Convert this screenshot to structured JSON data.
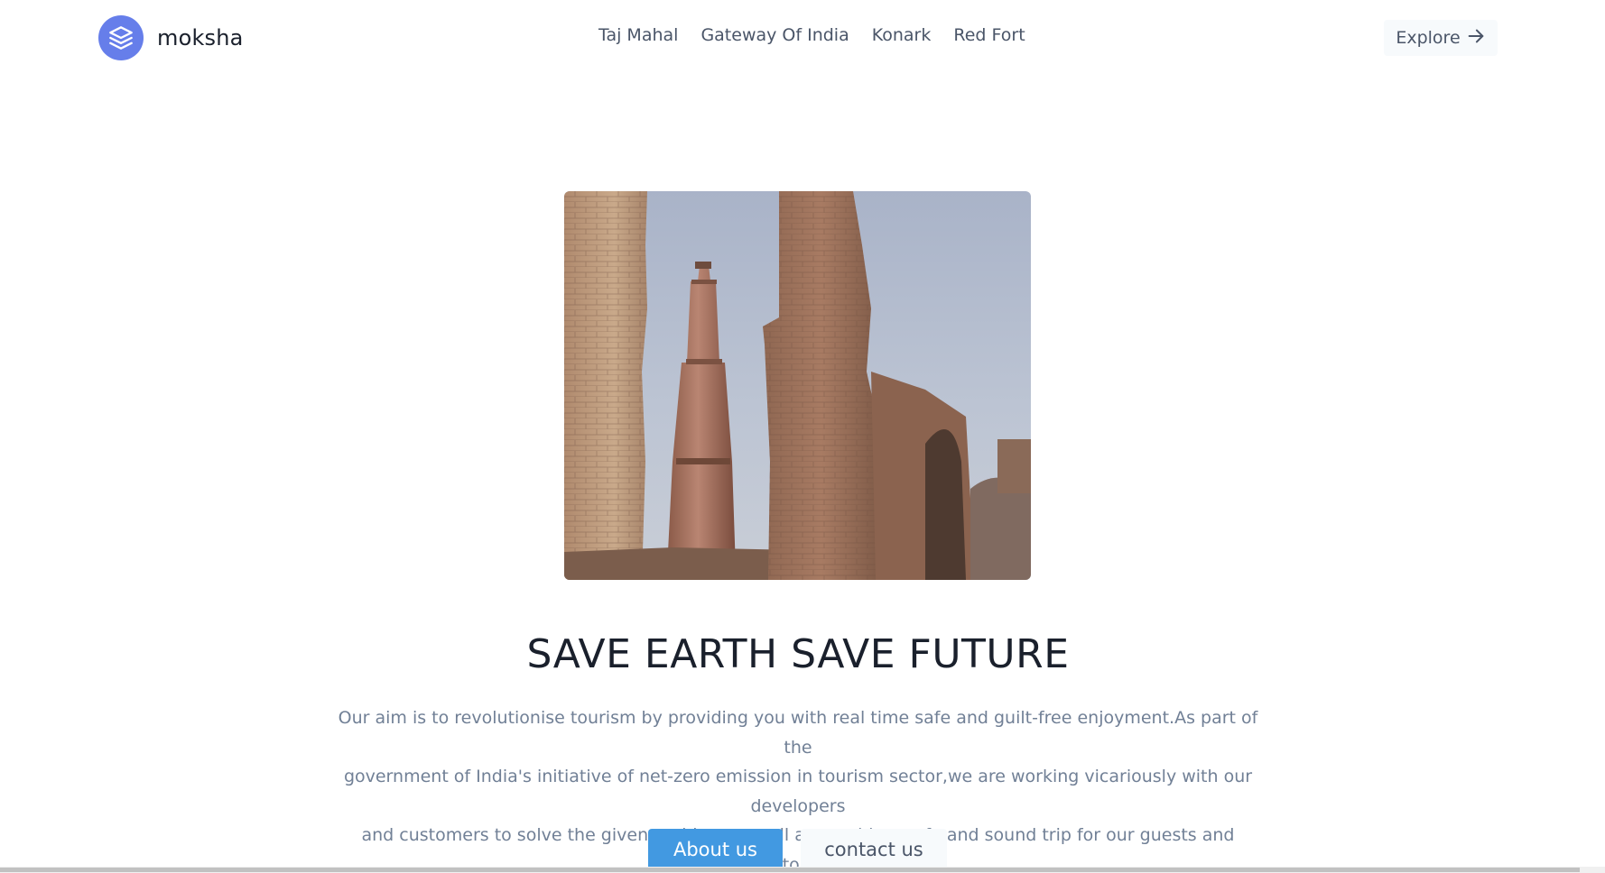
{
  "brand": {
    "name": "moksha",
    "icon": "layers-icon",
    "color": "#667eea"
  },
  "nav": {
    "items": [
      {
        "label": "Taj Mahal"
      },
      {
        "label": "Gateway Of India"
      },
      {
        "label": "Konark"
      },
      {
        "label": "Red Fort"
      }
    ],
    "explore_label": "Explore",
    "explore_icon": "arrow-right-icon"
  },
  "hero": {
    "image_subject": "Qutub Minar with ruined stone arches",
    "headline": "SAVE EARTH SAVE FUTURE",
    "description_lines": [
      "Our aim is to revolutionise tourism by providing you with real time safe and guilt-free enjoyment.As part of the",
      "government of India's initiative of net-zero emission in tourism sector,we are working vicariously with our developers",
      "and customers to solve the given problem as well as provide a safe and sound trip for our guests and customers"
    ]
  },
  "buttons": {
    "about_label": "About us",
    "contact_label": "contact us",
    "about_color": "#4299e1"
  }
}
